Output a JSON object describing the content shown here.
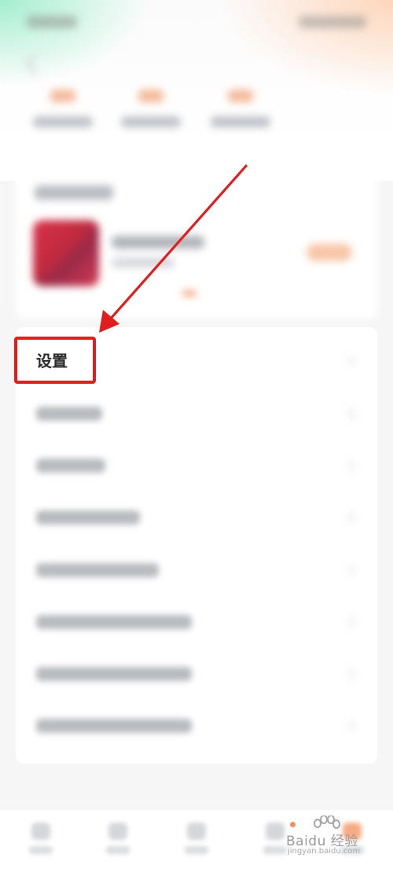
{
  "menu": {
    "settings_label": "设置",
    "items": [
      {
        "label": ""
      },
      {
        "label": ""
      },
      {
        "label": ""
      },
      {
        "label": ""
      },
      {
        "label": ""
      },
      {
        "label": ""
      },
      {
        "label": ""
      }
    ]
  },
  "watermark": {
    "text": "Baidu 经验",
    "sub": "jingyan.baidu.com"
  },
  "colors": {
    "annotation_red": "#e21d1d",
    "accent_orange": "#f28a52",
    "promo_red": "#d8324a"
  }
}
